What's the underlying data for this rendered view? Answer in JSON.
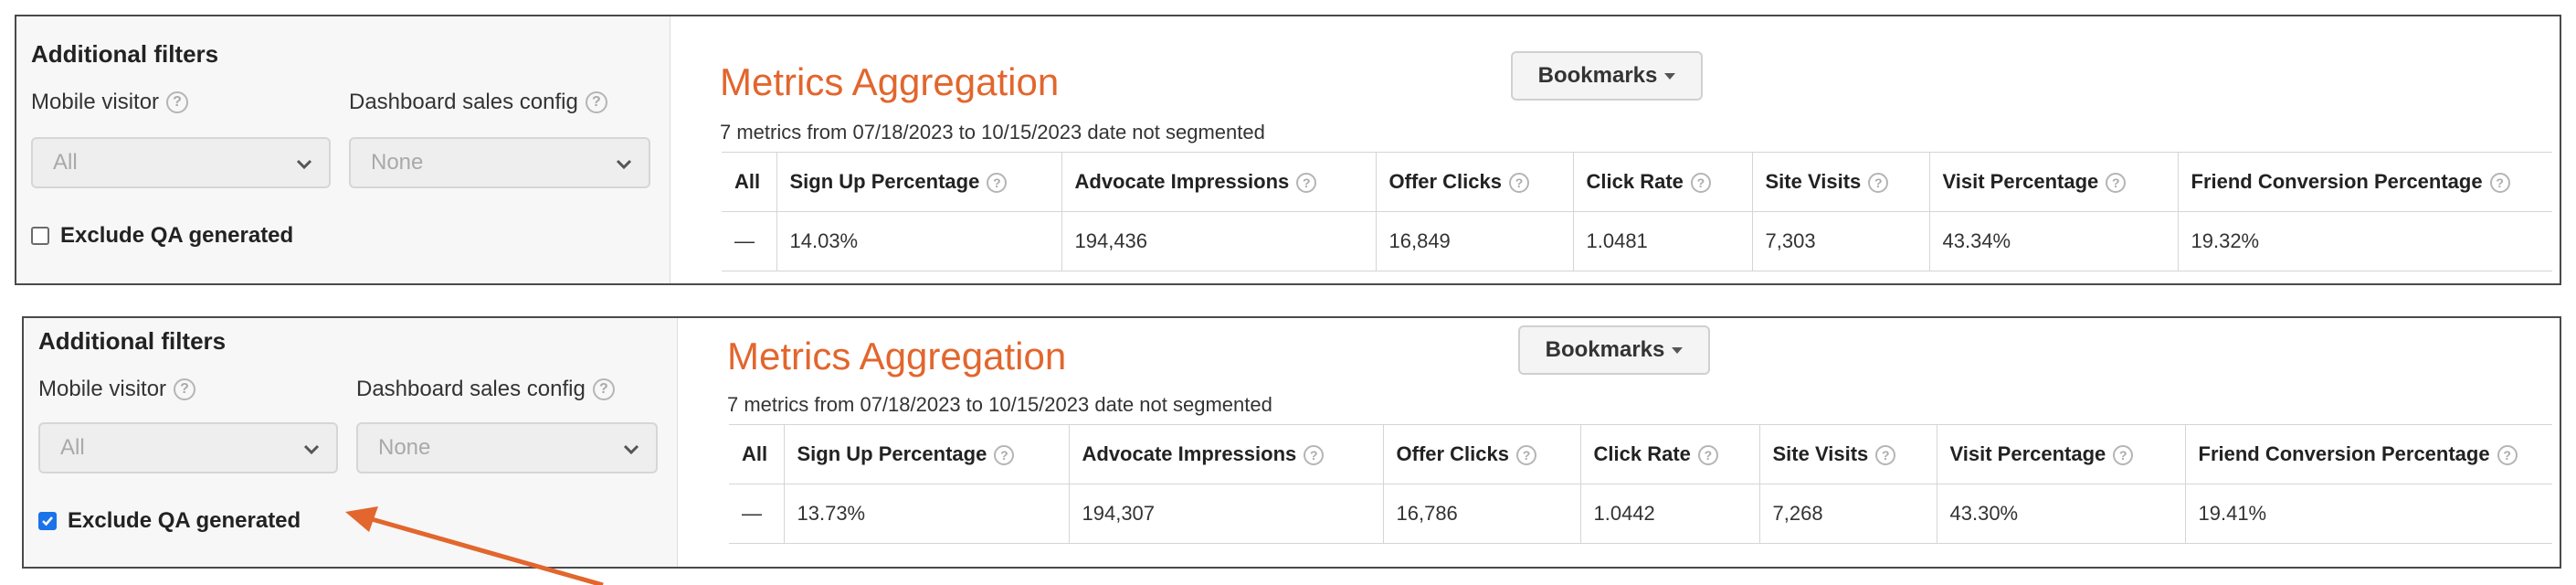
{
  "colors": {
    "accent": "#e2662d",
    "checkbox": "#1a73e8"
  },
  "panels": [
    {
      "filters": {
        "title": "Additional filters",
        "mobile_label": "Mobile visitor",
        "mobile_value": "All",
        "dashboard_label": "Dashboard sales config",
        "dashboard_value": "None",
        "qa_label": "Exclude QA generated",
        "qa_checked": false
      },
      "metrics": {
        "title": "Metrics Aggregation",
        "subtitle": "7 metrics from 07/18/2023 to 10/15/2023 date not segmented",
        "bookmarks": "Bookmarks",
        "headers": [
          "All",
          "Sign Up Percentage",
          "Advocate Impressions",
          "Offer Clicks",
          "Click Rate",
          "Site Visits",
          "Visit Percentage",
          "Friend Conversion Percentage"
        ],
        "row": [
          "—",
          "14.03%",
          "194,436",
          "16,849",
          "1.0481",
          "7,303",
          "43.34%",
          "19.32%"
        ]
      }
    },
    {
      "filters": {
        "title": "Additional filters",
        "mobile_label": "Mobile visitor",
        "mobile_value": "All",
        "dashboard_label": "Dashboard sales config",
        "dashboard_value": "None",
        "qa_label": "Exclude QA generated",
        "qa_checked": true
      },
      "metrics": {
        "title": "Metrics Aggregation",
        "subtitle": "7 metrics from 07/18/2023 to 10/15/2023 date not segmented",
        "bookmarks": "Bookmarks",
        "headers": [
          "All",
          "Sign Up Percentage",
          "Advocate Impressions",
          "Offer Clicks",
          "Click Rate",
          "Site Visits",
          "Visit Percentage",
          "Friend Conversion Percentage"
        ],
        "row": [
          "—",
          "13.73%",
          "194,307",
          "16,786",
          "1.0442",
          "7,268",
          "43.30%",
          "19.41%"
        ]
      }
    }
  ],
  "icons": {
    "help": "question-circle-icon",
    "chevron": "chevron-down-icon",
    "caret": "caret-down-icon",
    "annotation": "arrow-icon"
  }
}
